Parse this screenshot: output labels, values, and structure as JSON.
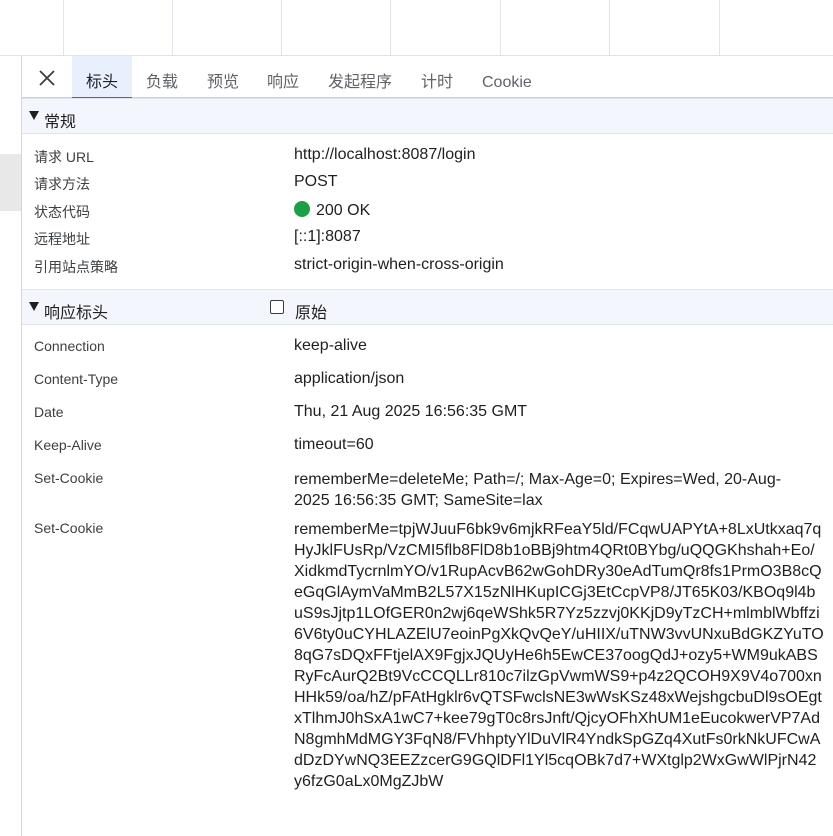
{
  "tabs": [
    {
      "label": "标头",
      "active": true
    },
    {
      "label": "负载"
    },
    {
      "label": "预览"
    },
    {
      "label": "响应"
    },
    {
      "label": "发起程序"
    },
    {
      "label": "计时"
    },
    {
      "label": "Cookie"
    }
  ],
  "general": {
    "title": "常规",
    "rows": [
      {
        "key": "请求 URL",
        "value": "http://localhost:8087/login"
      },
      {
        "key": "请求方法",
        "value": "POST"
      },
      {
        "key": "状态代码",
        "value": "200 OK"
      },
      {
        "key": "远程地址",
        "value": "[::1]:8087"
      },
      {
        "key": "引用站点策略",
        "value": "strict-origin-when-cross-origin"
      }
    ],
    "status_color": "#1e9e45"
  },
  "response_headers": {
    "title": "响应标头",
    "raw_label": "原始",
    "raw_checked": false,
    "rows": [
      {
        "key": "Connection",
        "value": "keep-alive"
      },
      {
        "key": "Content-Type",
        "value": "application/json"
      },
      {
        "key": "Date",
        "value": "Thu, 21 Aug 2025 16:56:35 GMT"
      },
      {
        "key": "Keep-Alive",
        "value": "timeout=60"
      },
      {
        "key": "Set-Cookie",
        "value": "rememberMe=deleteMe; Path=/; Max-Age=0; Expires=Wed, 20-Aug-2025 16:56:35 GMT; SameSite=lax"
      },
      {
        "key": "Set-Cookie",
        "value": "rememberMe=tpjWJuuF6bk9v6mjkRFeaY5ld/FCqwUAPYtA+8LxUtkxaq7qHyJklFUsRp/VzCMI5flb8FlD8b1oBBj9htm4QRt0BYbg/uQQGKhshah+Eo/XidkmdTycrnlmYO/v1RupAcvB62wGohDRy30eAdTumQr8fs1PrmO3B8cQeGqGlAymVaMmB2L57X15zNlHKupICGj3EtCcpVP8/JT65K03/KBOq9l4buS9sJjtp1LOfGER0n2wj6qeWShk5R7Yz5zzvj0KKjD9yTzCH+mlmblWbffzi6V6ty0uCYHLAZElU7eoinPgXkQvQeY/uHIIX/uTNW3vvUNxuBdGKZYuTO8qG7sDQxFFtjelAX9FgjxJQUyHe6h5EwCE37oogQdJ+ozy5+WM9ukABSRyFcAurQ2Bt9VcCCQLLr810c7ilzGpVwmWS9+p4z2QCOH9X9V4o700xnHHk59/oa/hZ/pFAtHgklr6vQTSFwclsNE3wWsKSz48xWejshgcbuDl9sOEgtxTlhmJ0hSxA1wC7+kee79gT0c8rsJnft/QjcyOFhXhUM1eEucokwerVP7AdN8gmhMdMGY3FqN8/FVhhptyYlDuVlR4YndkSpGZq4XutFs0rkNkUFCwAdDzDYwNQ3EEZzcerG9GQlDFl1Yl5cqOBk7d7+WXtglp2WxGwWlPjrN42y6fzG0aLx0MgZJbW"
      }
    ]
  }
}
